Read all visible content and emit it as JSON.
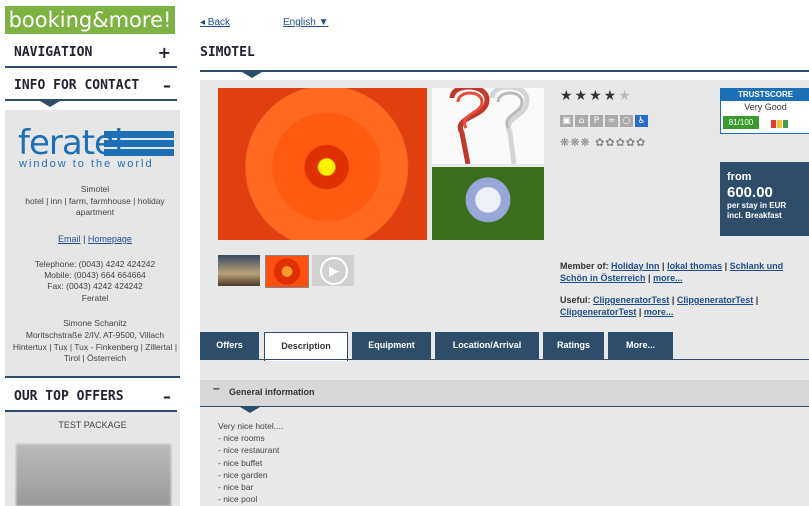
{
  "sidebar": {
    "logo": "booking&more!",
    "navigation": {
      "label": "NAVIGATION",
      "toggle": "+"
    },
    "contact": {
      "label": "INFO FOR CONTACT",
      "toggle": "–",
      "brand_word": "feratel",
      "brand_tagline": "window to the world",
      "name": "Simotel",
      "types": "hotel | inn | farm, farmhouse | holiday apartment",
      "email_label": "Email",
      "homepage_label": "Homepage",
      "separator": " | ",
      "telephone": "Telephone: (0043) 4242 424242",
      "mobile": "Mobile: (0043) 664 664664",
      "fax": "Fax: (0043) 4242 424242",
      "company": "Feratel",
      "person": "Simone Schanitz",
      "address": "Moritschstraße 2/IV, AT-9500, Villach",
      "regions": "Hintertux | Tux | Tux - Finkenberg | Zillertal | Tirol | Österreich"
    },
    "top_offers": {
      "label": "OUR TOP OFFERS",
      "toggle": "–",
      "package_title": "TEST PACKAGE"
    }
  },
  "main": {
    "back_label": "◂ Back",
    "language_label": "English ▼",
    "hotel_name": "SIMOTEL",
    "stars_on": "★★★★",
    "stars_off": "★",
    "amenity_icons": [
      "parking-icon",
      "restaurant-icon",
      "parking-p-icon",
      "sauna-icon",
      "pool-icon",
      "wheelchair-icon"
    ],
    "amenity_glyphs": [
      "▣",
      "⌂",
      "P",
      "≈",
      "○",
      "♿"
    ],
    "rating_row": "❋❋❋ ✿✿✿✿✿",
    "trustscore": {
      "header": "TRUSTSCORE",
      "verdict": "Very Good",
      "score": "81/100",
      "colors": [
        "#e53935",
        "#fbc02d",
        "#43a047"
      ]
    },
    "price": {
      "from": "from",
      "amount": "600.00",
      "per": "per stay in EUR",
      "board": "incl. Breakfast"
    },
    "member": {
      "label": "Member of:",
      "links": [
        "Holiday Inn",
        "lokal thomas",
        "Schlank und Schön in Österreich",
        "more..."
      ]
    },
    "useful": {
      "label": "Useful:",
      "links": [
        "ClipgeneratorTest",
        "ClipgeneratorTest",
        "ClipgeneratorTest",
        "more..."
      ]
    },
    "tabs": [
      "Offers",
      "Description",
      "Equipment",
      "Location/Arrival",
      "Ratings",
      "More..."
    ],
    "active_tab": "Description",
    "general_info": {
      "toggle": "–",
      "label": "General information"
    },
    "description_lines": [
      "Very nice hotel....",
      "- nice rooms",
      "- nice restaurant",
      "- nice buffet",
      "- nice garden",
      "- nice bar",
      "- nice pool"
    ]
  },
  "colors": {
    "accent": "#7cb342",
    "navy": "#2e4d6b",
    "link": "#1f4e8c",
    "panel": "#e8e8e8"
  }
}
